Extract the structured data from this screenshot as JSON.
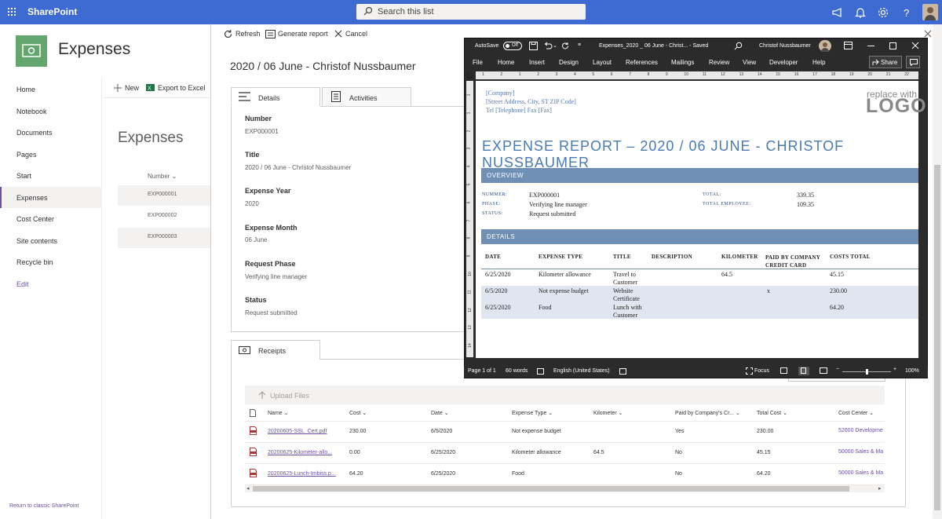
{
  "suitebar": {
    "brand": "SharePoint",
    "search_placeholder": "Search this list"
  },
  "site": {
    "title": "Expenses"
  },
  "leftnav": {
    "items": [
      {
        "label": "Home"
      },
      {
        "label": "Notebook"
      },
      {
        "label": "Documents"
      },
      {
        "label": "Pages"
      },
      {
        "label": "Start"
      },
      {
        "label": "Expenses"
      },
      {
        "label": "Cost Center"
      },
      {
        "label": "Site contents"
      },
      {
        "label": "Recycle bin"
      }
    ],
    "edit": "Edit",
    "classic": "Return to classic SharePoint"
  },
  "list": {
    "new": "New",
    "export": "Export to Excel",
    "title": "Expenses",
    "number_header": "Number",
    "rows": [
      "EXP000001",
      "EXP000002",
      "EXP000003"
    ]
  },
  "panel": {
    "toolbar": {
      "refresh": "Refresh",
      "generate": "Generate report",
      "cancel": "Cancel"
    },
    "title": "2020 / 06 June - Christof Nussbaumer",
    "tabs": {
      "details": "Details",
      "activities": "Activities",
      "receipts": "Receipts"
    },
    "fields": [
      {
        "label": "Number",
        "value": "EXP000001"
      },
      {
        "label": "Title",
        "value": "2020 / 06 June - Christof Nussbaumer"
      },
      {
        "label": "Expense Year",
        "value": "2020"
      },
      {
        "label": "Expense Month",
        "value": "06 June"
      },
      {
        "label": "Request Phase",
        "value": "Verifying line manager"
      },
      {
        "label": "Status",
        "value": "Request submitted"
      }
    ],
    "receipts": {
      "upload": "Upload Files",
      "headers": {
        "name": "Name",
        "cost": "Cost",
        "date": "Date",
        "type": "Expense Type",
        "km": "Kilometer",
        "paid": "Paid by Company's Cr...",
        "total": "Total Cost",
        "center": "Cost Center"
      },
      "rows": [
        {
          "name": "20200605-SSL_Cert.pdf",
          "cost": "230.00",
          "date": "6/5/2020",
          "type": "Not expense budget",
          "km": "",
          "paid": "Yes",
          "total": "230.00",
          "center": "52000 Developme"
        },
        {
          "name": "20200625-Kilometer-allo...",
          "cost": "0.00",
          "date": "6/25/2020",
          "type": "Kilometer allowance",
          "km": "64.5",
          "paid": "No",
          "total": "45.15",
          "center": "50000 Sales & Ma"
        },
        {
          "name": "20200625-Lunch-Imbiss.p...",
          "cost": "64.20",
          "date": "6/25/2020",
          "type": "Food",
          "km": "",
          "paid": "No",
          "total": "64.20",
          "center": "50000 Sales & Ma"
        }
      ]
    }
  },
  "word": {
    "autosave": "AutoSave",
    "autosave_state": "Off",
    "doc_title": "Expenses_2020 _ 06 June - Christ... - Saved",
    "user": "Christof Nussbaumer",
    "menu": [
      "File",
      "Home",
      "Insert",
      "Design",
      "Layout",
      "References",
      "Mailings",
      "Review",
      "View",
      "Developer",
      "Help"
    ],
    "share": "Share",
    "ruler": [
      "1",
      "2",
      "1",
      "2",
      "3",
      "4",
      "5",
      "6",
      "7",
      "8",
      "9",
      "10",
      "11",
      "12",
      "13",
      "14",
      "15",
      "16",
      "17",
      "18",
      "19",
      "20",
      "21",
      "22",
      "23"
    ],
    "vruler": [
      "1",
      "1",
      "2",
      "3",
      "4",
      "5",
      "6",
      "7",
      "8",
      "9",
      "10",
      "11",
      "12",
      "13",
      "14"
    ],
    "company": [
      "[Company]",
      "[Street Address, City, ST  ZIP Code]",
      "Tel [Telephone]  Fax [Fax]"
    ],
    "logo": [
      "replace with",
      "LOGO"
    ],
    "report_title": "EXPENSE REPORT – 2020 / 06 JUNE - CHRISTOF NUSSBAUMER",
    "overview": "OVERVIEW",
    "ov_left": [
      {
        "label": "NUMMER:",
        "value": "EXP000001"
      },
      {
        "label": "PHASE:",
        "value": "Verifying line manager"
      },
      {
        "label": "STATUS:",
        "value": "Request submitted"
      }
    ],
    "ov_right": [
      {
        "label": "TOTAL:",
        "value": "339.35"
      },
      {
        "label": "TOTAL EMPLOYEE:",
        "value": "109.35"
      }
    ],
    "details": "DETAILS",
    "table_headers": [
      "DATE",
      "EXPENSE TYPE",
      "TITLE",
      "DESCRIPTION",
      "KILOMETER",
      "PAID BY COMPANY CREDIT CARD",
      "COSTS TOTAL"
    ],
    "table_rows": [
      {
        "date": "6/25/2020",
        "type": "Kilometer allowance",
        "title": "Travel to Customer",
        "desc": "",
        "km": "64.5",
        "paid": "",
        "total": "45.15"
      },
      {
        "date": "6/5/2020",
        "type": "Not expense budget",
        "title": "Website Certificate",
        "desc": "",
        "km": "",
        "paid": "x",
        "total": "230.00"
      },
      {
        "date": "6/25/2020",
        "type": "Food",
        "title": "Lunch with Customer",
        "desc": "",
        "km": "",
        "paid": "",
        "total": "64.20"
      }
    ],
    "status": {
      "page": "Page 1 of 1",
      "words": "60 words",
      "lang": "English (United States)",
      "focus": "Focus",
      "zoom": "100%"
    }
  }
}
